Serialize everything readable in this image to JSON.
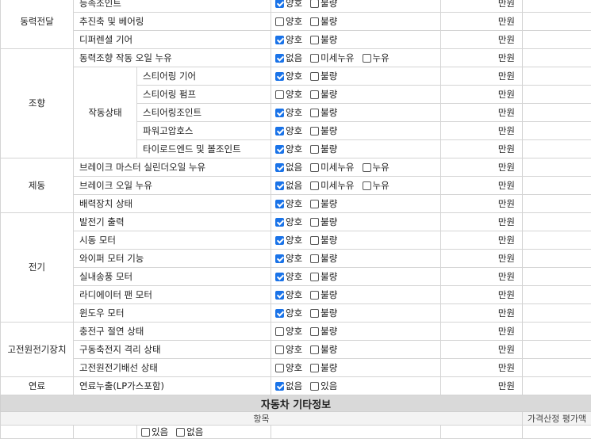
{
  "unit": "만원",
  "categories": {
    "power": "동력전달",
    "steering": "조향",
    "brake": "제동",
    "electric": "전기",
    "hv": "고전원전기장치",
    "fuel": "연료"
  },
  "steering_sub": "작동상태",
  "rows": {
    "r1": {
      "label": "등속조인트",
      "options": [
        "양호",
        "불량"
      ]
    },
    "r2": {
      "label": "추진축 및 베어링",
      "options": [
        "양호",
        "불량"
      ]
    },
    "r3": {
      "label": "디퍼렌셜 기어",
      "options": [
        "양호",
        "불량"
      ]
    },
    "r4": {
      "label": "동력조향 작동 오일 누유",
      "options": [
        "없음",
        "미세누유",
        "누유"
      ]
    },
    "r5": {
      "label": "스티어링 기어",
      "options": [
        "양호",
        "불량"
      ]
    },
    "r6": {
      "label": "스티어링 펌프",
      "options": [
        "양호",
        "불량"
      ]
    },
    "r7": {
      "label": "스티어링조인트",
      "options": [
        "양호",
        "불량"
      ]
    },
    "r8": {
      "label": "파워고압호스",
      "options": [
        "양호",
        "불량"
      ]
    },
    "r9": {
      "label": "타이로드엔드 및 볼조인트",
      "options": [
        "양호",
        "불량"
      ]
    },
    "r10": {
      "label": "브레이크 마스터 실린더오일 누유",
      "options": [
        "없음",
        "미세누유",
        "누유"
      ]
    },
    "r11": {
      "label": "브레이크 오일 누유",
      "options": [
        "없음",
        "미세누유",
        "누유"
      ]
    },
    "r12": {
      "label": "배력장치 상태",
      "options": [
        "양호",
        "불량"
      ]
    },
    "r13": {
      "label": "발전기 출력",
      "options": [
        "양호",
        "불량"
      ]
    },
    "r14": {
      "label": "시동 모터",
      "options": [
        "양호",
        "불량"
      ]
    },
    "r15": {
      "label": "와이퍼 모터 기능",
      "options": [
        "양호",
        "불량"
      ]
    },
    "r16": {
      "label": "실내송풍 모터",
      "options": [
        "양호",
        "불량"
      ]
    },
    "r17": {
      "label": "라디에이터 팬 모터",
      "options": [
        "양호",
        "불량"
      ]
    },
    "r18": {
      "label": "윈도우 모터",
      "options": [
        "양호",
        "불량"
      ]
    },
    "r19": {
      "label": "충전구 절연 상태",
      "options": [
        "양호",
        "불량"
      ]
    },
    "r20": {
      "label": "구동축전지 격리 상태",
      "options": [
        "양호",
        "불량"
      ]
    },
    "r21": {
      "label": "고전원전기배선 상태",
      "options": [
        "양호",
        "불량"
      ]
    },
    "r22": {
      "label": "연료누출(LP가스포함)",
      "options": [
        "없음",
        "있음"
      ]
    }
  },
  "checked": {
    "r1": [
      true,
      false
    ],
    "r2": [
      false,
      false
    ],
    "r3": [
      true,
      false
    ],
    "r4": [
      true,
      false,
      false
    ],
    "r5": [
      true,
      false
    ],
    "r6": [
      false,
      false
    ],
    "r7": [
      true,
      false
    ],
    "r8": [
      true,
      false
    ],
    "r9": [
      true,
      false
    ],
    "r10": [
      true,
      false,
      false
    ],
    "r11": [
      true,
      false,
      false
    ],
    "r12": [
      true,
      false
    ],
    "r13": [
      true,
      false
    ],
    "r14": [
      true,
      false
    ],
    "r15": [
      true,
      false
    ],
    "r16": [
      true,
      false
    ],
    "r17": [
      true,
      false
    ],
    "r18": [
      true,
      false
    ],
    "r19": [
      false,
      false
    ],
    "r20": [
      false,
      false
    ],
    "r21": [
      false,
      false
    ],
    "r22": [
      true,
      false
    ]
  },
  "other_info": {
    "title": "자동차 기타정보",
    "col_item": "항목",
    "col_price": "가격산정 평가액",
    "partial_options": [
      "있음",
      "없음"
    ]
  }
}
